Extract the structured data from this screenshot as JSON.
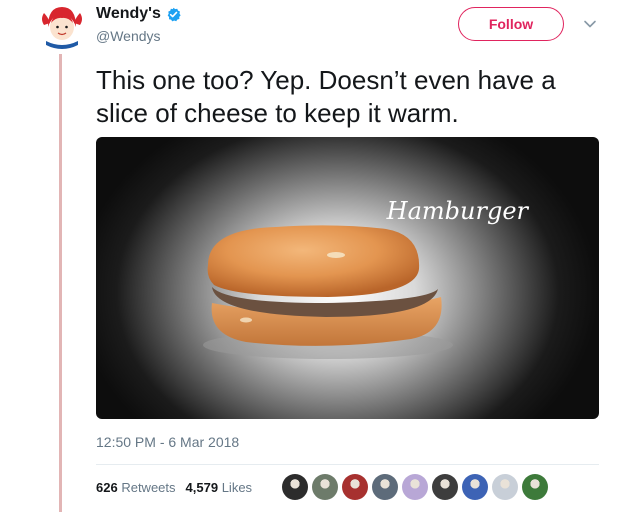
{
  "user": {
    "display_name": "Wendy's",
    "handle": "@Wendys",
    "avatar_icon": "wendys-logo-avatar",
    "verified_icon": "verified-badge-icon"
  },
  "follow_label": "Follow",
  "tweet_text_line1": "This one too? Yep. Doesn’t even have a",
  "tweet_text_line2": "slice of cheese to keep it warm.",
  "media": {
    "caption": "Hamburger",
    "description_icon": "hamburger-photo"
  },
  "timestamp": "12:50 PM - 6 Mar 2018",
  "stats": {
    "retweets_count": "626",
    "retweets_label": "Retweets",
    "likes_count": "4,579",
    "likes_label": "Likes"
  },
  "colors": {
    "follow_accent": "#e0245e",
    "verified_blue": "#1da1f2",
    "thread_line": "#e2b5b5",
    "muted_text": "#657786"
  },
  "liker_avatars": [
    "#2c2c2c",
    "#6d7b6a",
    "#a7312f",
    "#5d6b7a",
    "#b8a7d6",
    "#3d3d3d",
    "#3d63b5",
    "#c8cfd8",
    "#3d7a3a"
  ]
}
